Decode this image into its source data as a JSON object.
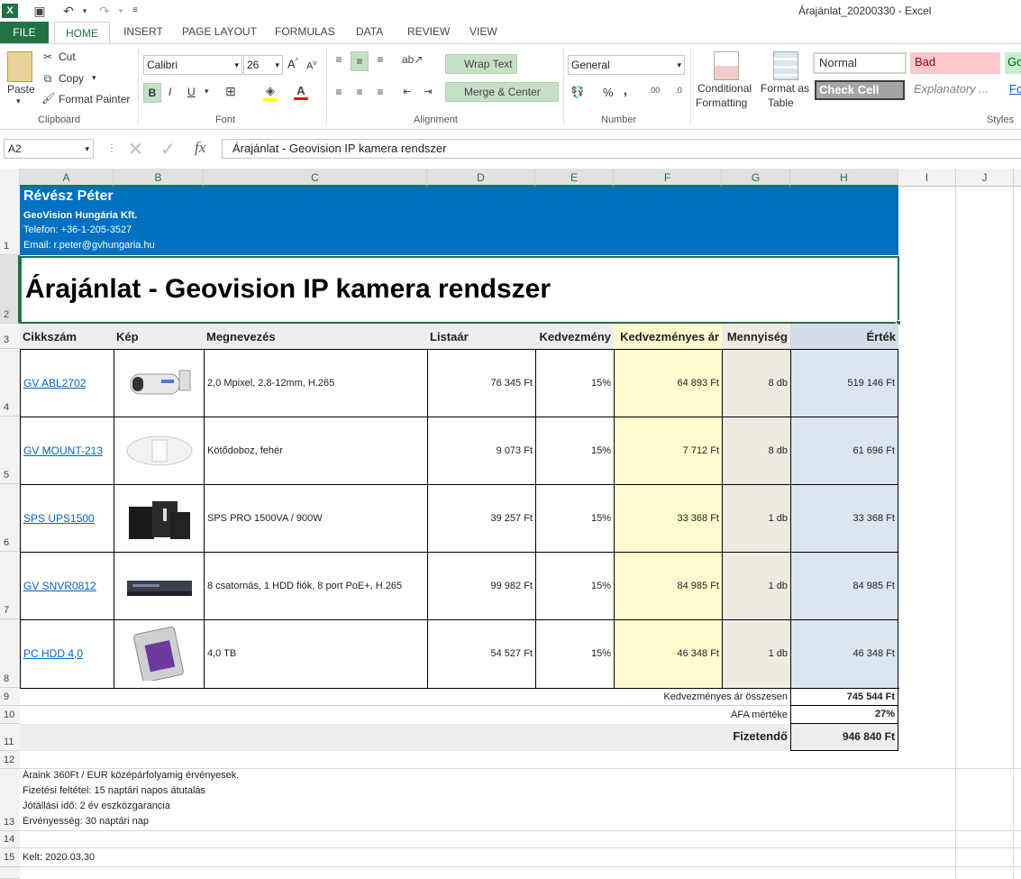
{
  "window": {
    "title": "Árajánlat_20200330 - Excel"
  },
  "ribbon": {
    "tabs": [
      "FILE",
      "HOME",
      "INSERT",
      "PAGE LAYOUT",
      "FORMULAS",
      "DATA",
      "REVIEW",
      "VIEW"
    ],
    "clipboard": {
      "paste": "Paste",
      "cut": "Cut",
      "copy": "Copy",
      "format_painter": "Format Painter",
      "label": "Clipboard"
    },
    "font": {
      "name": "Calibri",
      "size": "26",
      "bold": "B",
      "italic": "I",
      "underline": "U",
      "label": "Font"
    },
    "alignment": {
      "wrap": "Wrap Text",
      "merge": "Merge & Center",
      "label": "Alignment"
    },
    "number": {
      "format": "General",
      "percent": "%",
      "comma": ",",
      "label": "Number"
    },
    "styles": {
      "conditional": "Conditional",
      "formatting": "Formatting",
      "format_as": "Format as",
      "table": "Table",
      "normal": "Normal",
      "bad": "Bad",
      "good": "Go",
      "check_cell": "Check Cell",
      "explanatory": "Explanatory ...",
      "fo": "Fo",
      "label": "Styles"
    }
  },
  "formula_bar": {
    "name_box": "A2",
    "fx": "fx",
    "content": "Árajánlat - Geovision IP kamera rendszer"
  },
  "columns": [
    "A",
    "B",
    "C",
    "D",
    "E",
    "F",
    "G",
    "H",
    "I",
    "J"
  ],
  "rows": [
    "1",
    "2",
    "3",
    "4",
    "5",
    "6",
    "7",
    "8",
    "9",
    "10",
    "11",
    "12",
    "13",
    "14",
    "15",
    "16"
  ],
  "header_block": {
    "name": "Révész Péter",
    "company": "GeoVision Hungária Kft.",
    "phone": "Telefon: +36-1-205-3527",
    "email": "Email: r.peter@gvhungaria.hu",
    "title": "Árajánlat - Geovision IP kamera rendszer"
  },
  "table": {
    "headers": [
      "Cikkszám",
      "Kép",
      "Megnevezés",
      "Listaár",
      "Kedvezmény",
      "Kedvezményes ár",
      "Mennyiség",
      "Érték"
    ],
    "rows": [
      {
        "sku": "GV ABL2702",
        "desc": "2,0 Mpixel, 2,8-12mm, H.265",
        "list": "76 345 Ft",
        "disc": "15%",
        "price": "64 893 Ft",
        "qty": "8 db",
        "value": "519 146 Ft",
        "img": "camera"
      },
      {
        "sku": "GV MOUNT-213",
        "desc": "Kötődoboz, fehér",
        "list": "9 073 Ft",
        "disc": "15%",
        "price": "7 712 Ft",
        "qty": "8 db",
        "value": "61 696 Ft",
        "img": "mount"
      },
      {
        "sku": "SPS UPS1500",
        "desc": "SPS PRO 1500VA / 900W",
        "list": "39 257 Ft",
        "disc": "15%",
        "price": "33 368 Ft",
        "qty": "1 db",
        "value": "33 368 Ft",
        "img": "ups"
      },
      {
        "sku": "GV SNVR0812",
        "desc": "8 csatornás, 1 HDD fiók, 8 port PoE+, H.265",
        "list": "99 982 Ft",
        "disc": "15%",
        "price": "84 985 Ft",
        "qty": "1 db",
        "value": "84 985 Ft",
        "img": "nvr"
      },
      {
        "sku": "PC HDD 4,0",
        "desc": "4,0 TB",
        "list": "54 527 Ft",
        "disc": "15%",
        "price": "46 348 Ft",
        "qty": "1 db",
        "value": "46 348 Ft",
        "img": "hdd"
      }
    ]
  },
  "totals": {
    "subtotal_label": "Kedvezményes ár összesen",
    "subtotal": "745 544 Ft",
    "vat_label": "ÁFA mértéke",
    "vat": "27%",
    "total_label": "Fizetendő",
    "total": "946 840 Ft"
  },
  "notes": [
    "Áraink 360Ft / EUR középárfolyamig érvényesek.",
    "Fizetési feltétel: 15 naptári napos átutalás",
    "Jótállási idő: 2 év eszközgarancia",
    "Érvényesség: 30 naptári nap"
  ],
  "date": "Kelt: 2020.03.30",
  "colors": {
    "excel_green": "#217346",
    "header_blue": "#0070c0",
    "price_yellow": "#fefccf",
    "qty_beige": "#eeece1",
    "value_blue": "#dce6f1",
    "header_gray": "#eeeeee"
  }
}
